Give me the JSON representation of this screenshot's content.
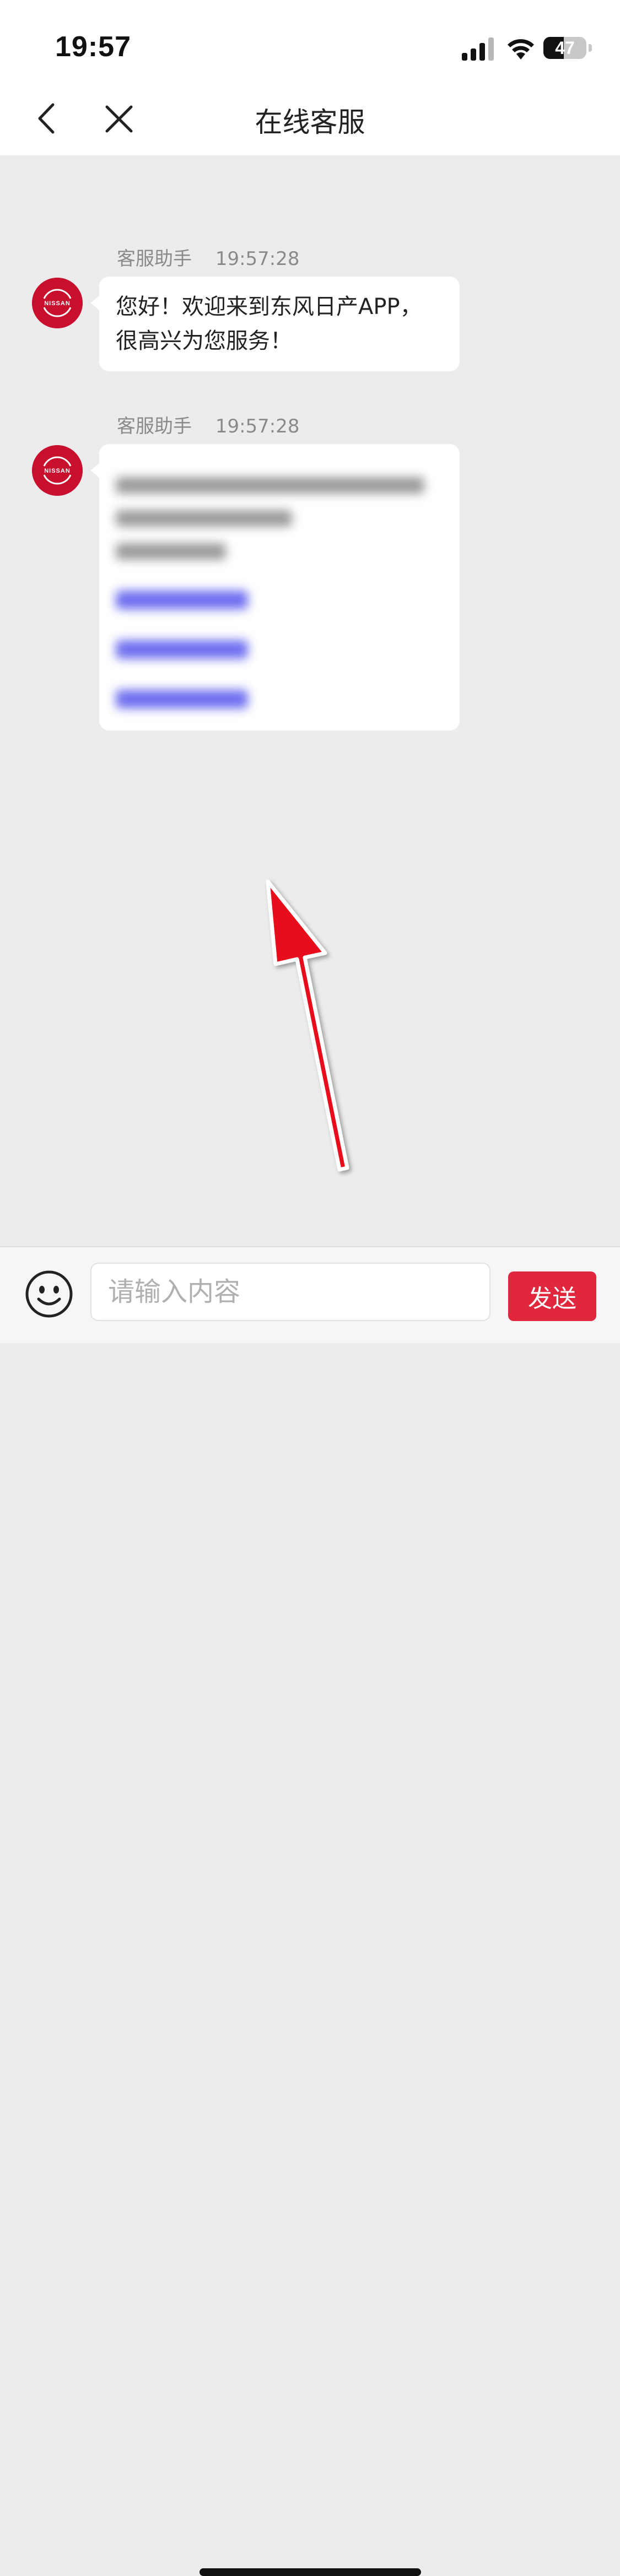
{
  "status_bar": {
    "time": "19:57",
    "battery_level": "47",
    "battery_fraction": 0.47,
    "icons": [
      "signal-icon",
      "wifi-icon",
      "battery-icon"
    ]
  },
  "nav": {
    "title": "在线客服",
    "icons": [
      "chevron-left-icon",
      "close-icon"
    ]
  },
  "messages": [
    {
      "sender": "客服助手",
      "time": "19:57:28",
      "text": "您好！欢迎来到东风日产APP，很高兴为您服务！",
      "avatar": "nissan-logo"
    },
    {
      "sender": "客服助手",
      "time": "19:57:28",
      "text": "",
      "avatar": "nissan-logo",
      "blurred": true
    }
  ],
  "input_bar": {
    "placeholder": "请输入内容",
    "send_label": "发送",
    "icons": [
      "emoji-icon"
    ]
  },
  "colors": {
    "accent": "#e0273d",
    "avatar_red": "#c8102e",
    "chat_background": "#ececec",
    "link_blue": "#6f6ff0",
    "arrow_red": "#e8101a"
  }
}
